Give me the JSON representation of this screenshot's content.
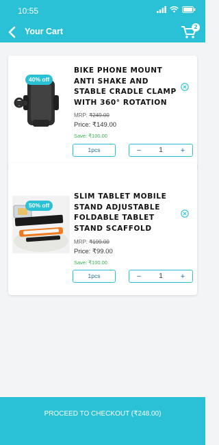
{
  "status_bar": {
    "time": "10:55"
  },
  "header": {
    "title": "Your Cart",
    "cart_count": "2"
  },
  "cart": {
    "items": [
      {
        "discount": "40% off",
        "name": "BIKE PHONE MOUNT ANTI SHAKE AND STABLE CRADLE CLAMP WITH 360° ROTATION",
        "mrp_label": "MRP: ",
        "mrp": "₹249.00",
        "price": "Price: ₹149.00",
        "save": "Save: ₹100.00",
        "unit": "1pcs",
        "quantity": "1"
      },
      {
        "discount": "50% off",
        "name": "SLIM TABLET MOBILE STAND ADJUSTABLE FOLDABLE TABLET STAND SCAFFOLD",
        "mrp_label": "MRP: ",
        "mrp": "₹199.00",
        "price": "Price: ₹99.00",
        "save": "Save: ₹100.00",
        "unit": "1pcs",
        "quantity": "1"
      }
    ],
    "stepper": {
      "minus": "−",
      "plus": "+"
    }
  },
  "checkout": {
    "label": "PROCEED TO CHECKOUT (₹248.00)"
  },
  "colors": {
    "accent": "#2ac1d6",
    "save_green": "#31b24a"
  }
}
